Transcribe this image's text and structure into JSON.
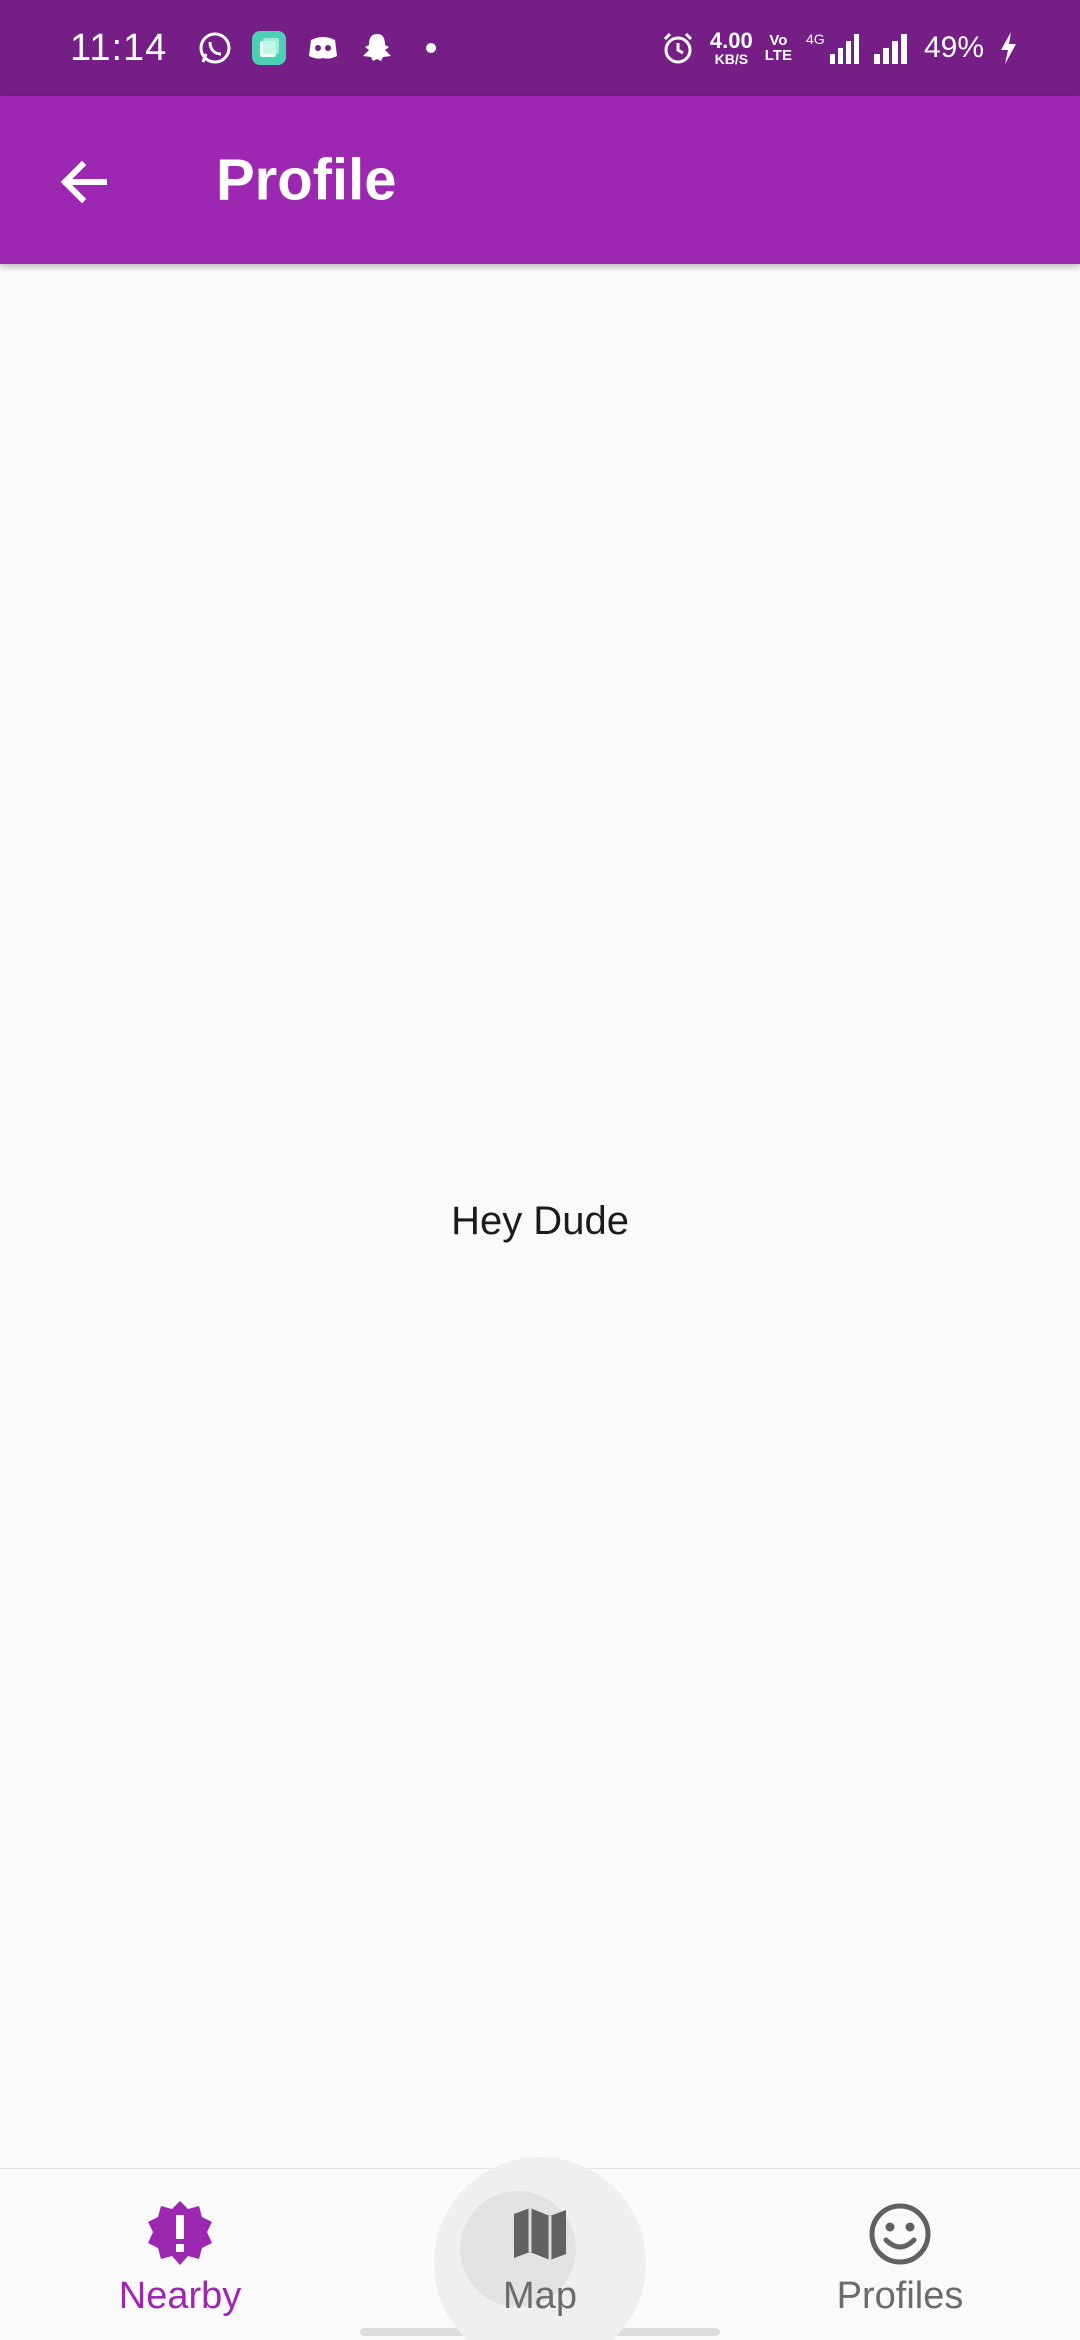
{
  "status_bar": {
    "time": "11:14",
    "left_icons": [
      "whatsapp-icon",
      "app-icon",
      "discord-icon",
      "snapchat-icon",
      "notification-dot-icon"
    ],
    "speed_value": "4.00",
    "speed_unit": "KB/S",
    "volte_top": "Vo",
    "volte_bottom": "LTE",
    "network_type": "4G",
    "battery": "49%",
    "bar_color": "#751e85"
  },
  "app_bar": {
    "title": "Profile",
    "back_icon": "arrow-back-icon",
    "color": "#9c27b0"
  },
  "main": {
    "text": "Hey Dude"
  },
  "bottom_nav": {
    "items": [
      {
        "label": "Nearby",
        "icon": "new-releases-icon",
        "active": true
      },
      {
        "label": "Map",
        "icon": "map-icon",
        "active": false
      },
      {
        "label": "Profiles",
        "icon": "smiley-face-icon",
        "active": false
      }
    ],
    "active_color": "#9c27b0",
    "inactive_color": "#6b6b6b"
  }
}
